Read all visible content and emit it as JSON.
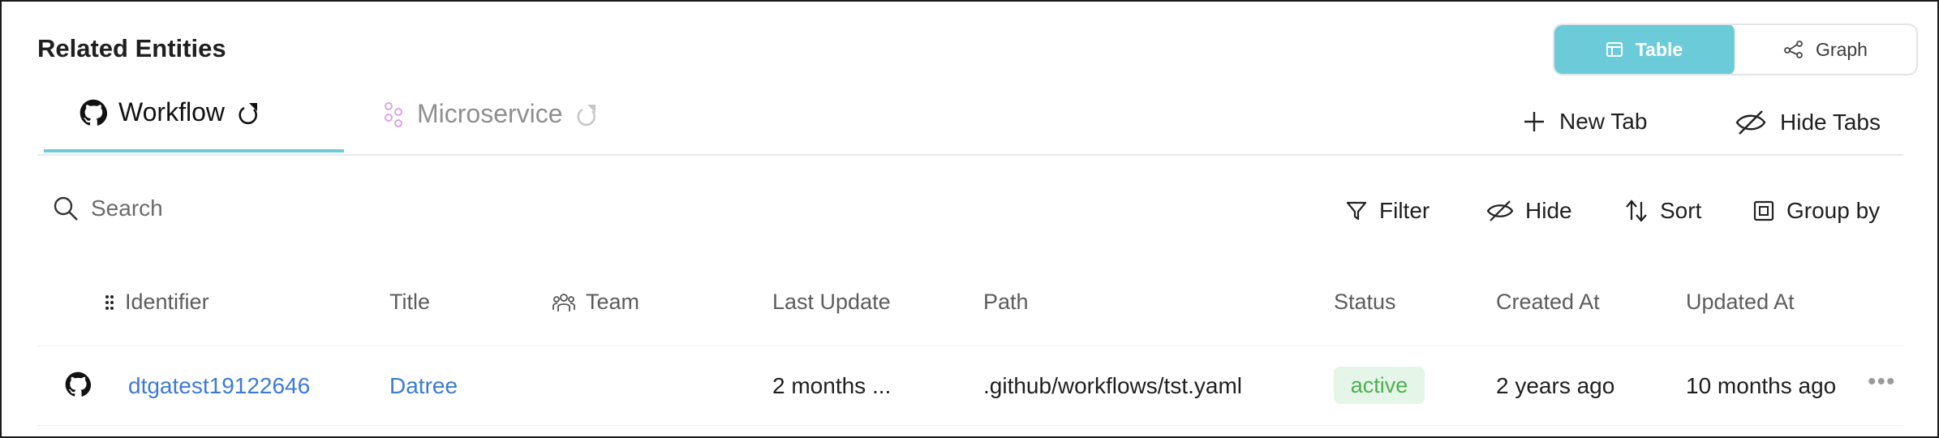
{
  "header": {
    "title": "Related Entities"
  },
  "view_toggle": {
    "table_label": "Table",
    "graph_label": "Graph",
    "selected": "Table"
  },
  "tabs": [
    {
      "label": "Workflow",
      "active": true
    },
    {
      "label": "Microservice",
      "active": false
    }
  ],
  "tab_actions": {
    "new_tab": "New Tab",
    "hide_tabs": "Hide Tabs"
  },
  "toolbar": {
    "search_placeholder": "Search",
    "filter": "Filter",
    "hide": "Hide",
    "sort": "Sort",
    "group_by": "Group by"
  },
  "table": {
    "columns": [
      "Identifier",
      "Title",
      "Team",
      "Last Update",
      "Path",
      "Status",
      "Created At",
      "Updated At"
    ],
    "rows": [
      {
        "identifier": "dtgatest19122646",
        "title": "Datree",
        "team": "",
        "last_update": "2 months ...",
        "path": ".github/workflows/tst.yaml",
        "status": "active",
        "created_at": "2 years ago",
        "updated_at": "10 months ago"
      }
    ]
  },
  "colors": {
    "accent": "#6ccbd9",
    "link": "#3d7ad6",
    "status_active_bg": "#e5f5e8",
    "status_active_text": "#4caf50"
  }
}
